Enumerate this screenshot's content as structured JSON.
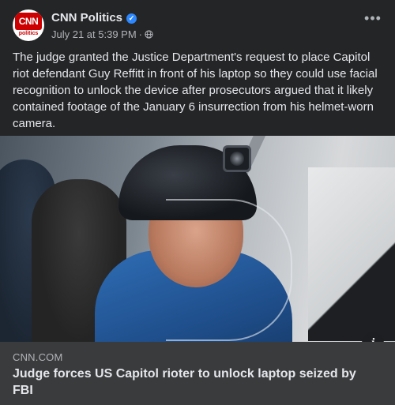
{
  "post": {
    "page_name": "CNN Politics",
    "avatar": {
      "logo_text": "CNN",
      "logo_subtext": "politics"
    },
    "timestamp": "July 21 at 5:39 PM",
    "separator": "·",
    "audience_icon": "globe-icon",
    "more_icon": "more-options-icon",
    "more_label": "•••",
    "verified_icon": "verified-badge-icon",
    "caption": "The judge granted the Justice Department's request to place Capitol riot defendant Guy Reffitt in front of his laptop so they could use facial recognition to unlock the device after prosecutors argued that it likely contained footage of the January 6 insurrection from his helmet-worn camera."
  },
  "link_preview": {
    "domain": "CNN.COM",
    "title": "Judge forces US Capitol rioter to unlock laptop seized by FBI",
    "info_icon": "info-icon",
    "info_label": "i"
  },
  "colors": {
    "background": "#242526",
    "link_preview_bg": "#3a3b3c",
    "primary_text": "#e4e6eb",
    "secondary_text": "#b0b3b8",
    "verified": "#2d88ff",
    "cnn_red": "#cc0000"
  }
}
